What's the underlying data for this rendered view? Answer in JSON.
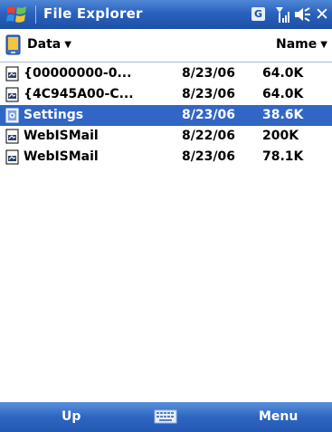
{
  "titlebar": {
    "title": "File Explorer",
    "status_badge": "G",
    "close_glyph": "✕",
    "icons": [
      "windows-start-icon",
      "signal-strength-icon",
      "volume-icon",
      "close-icon"
    ]
  },
  "header": {
    "folder_label": "Data",
    "sort_label": "Name",
    "caret": "▼"
  },
  "files": [
    {
      "name": "{00000000-0...",
      "date": "8/23/06",
      "size": "64.0K",
      "selected": false
    },
    {
      "name": "{4C945A00-C...",
      "date": "8/23/06",
      "size": "64.0K",
      "selected": false
    },
    {
      "name": "Settings",
      "date": "8/23/06",
      "size": "38.6K",
      "selected": true
    },
    {
      "name": "WebISMail",
      "date": "8/22/06",
      "size": "200K",
      "selected": false
    },
    {
      "name": "WebISMail",
      "date": "8/23/06",
      "size": "78.1K",
      "selected": false
    }
  ],
  "menubar": {
    "left_softkey": "Up",
    "right_softkey": "Menu",
    "center_icon": "keyboard-icon"
  },
  "colors": {
    "titlebar": "#2a62be",
    "selection": "#3166c5",
    "menubar": "#2d66c1"
  }
}
